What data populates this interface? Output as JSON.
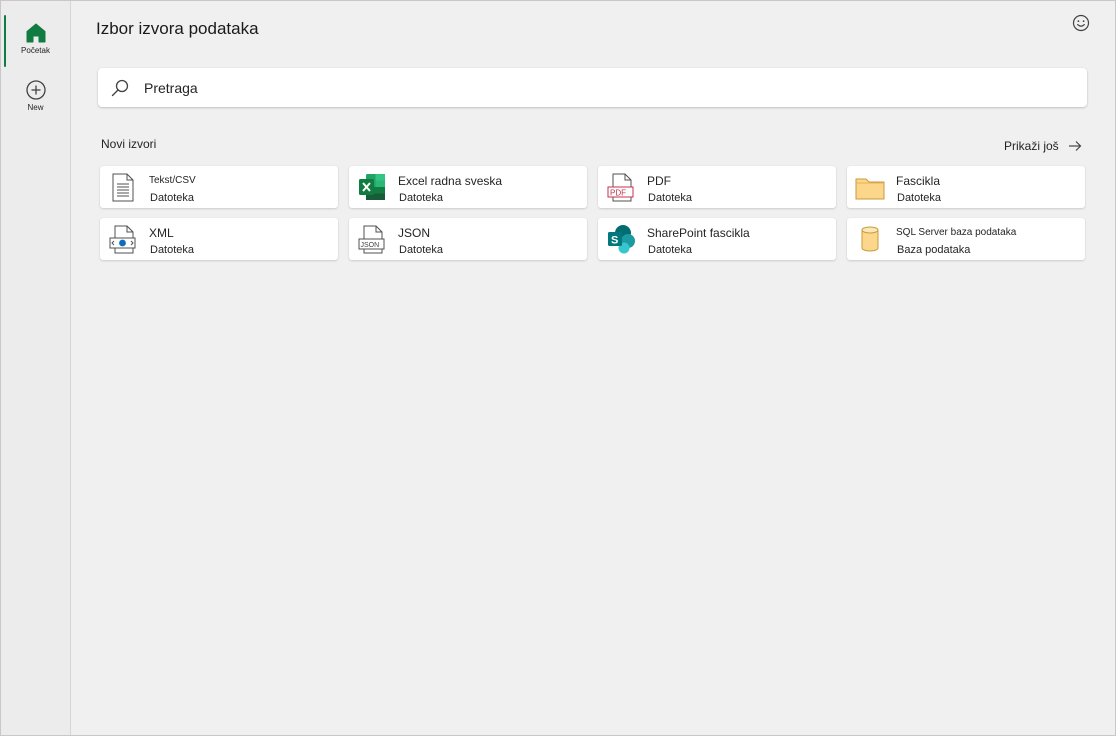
{
  "rail": {
    "items": [
      {
        "label": "Početak"
      },
      {
        "label": "New"
      }
    ]
  },
  "page": {
    "title": "Izbor izvora podataka"
  },
  "search": {
    "placeholder": "Pretraga"
  },
  "section": {
    "title": "Novi izvori",
    "show_more": "Prikaži još"
  },
  "sources": [
    {
      "name": "Tekst/CSV",
      "type": "Datoteka",
      "icon": "text-file-icon"
    },
    {
      "name": "Excel radna sveska",
      "type": "Datoteka",
      "icon": "excel-icon"
    },
    {
      "name": "PDF",
      "type": "Datoteka",
      "icon": "pdf-icon"
    },
    {
      "name": "Fascikla",
      "type": "Datoteka",
      "icon": "folder-icon"
    },
    {
      "name": "XML",
      "type": "Datoteka",
      "icon": "xml-file-icon"
    },
    {
      "name": "JSON",
      "type": "Datoteka",
      "icon": "json-file-icon"
    },
    {
      "name": "SharePoint fascikla",
      "type": "Datoteka",
      "icon": "sharepoint-icon"
    },
    {
      "name": "SQL Server baza podataka",
      "type": "Baza podataka",
      "icon": "database-icon"
    }
  ],
  "colors": {
    "accent": "#107c41",
    "background": "#f0f0f0"
  }
}
